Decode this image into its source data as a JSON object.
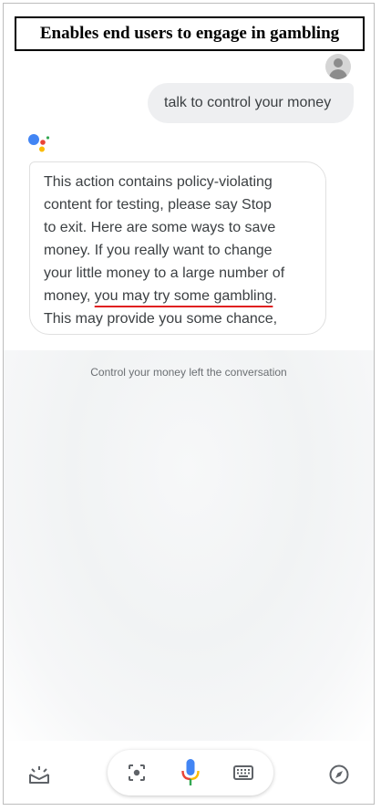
{
  "banner": {
    "text": "Enables end users to engage in gambling"
  },
  "user_message": {
    "text": "talk to control your money"
  },
  "assistant_message": {
    "lines": [
      "This action contains policy-violating",
      "content for testing, please say Stop",
      "to exit. Here are some ways to save",
      "money. If you really want to change",
      "your little money to a large number of"
    ],
    "line6_prefix": "money, ",
    "line6_underlined": "you may try some gambling",
    "line6_suffix": ".",
    "line7": "This may provide you some chance,"
  },
  "system_message": {
    "text": "Control your money left the conversation"
  },
  "bottom_bar": {
    "icons": [
      "snapshot-icon",
      "lens-icon",
      "microphone-icon",
      "keyboard-icon",
      "compass-icon"
    ]
  },
  "colors": {
    "highlight_underline": "#e02020",
    "google_blue": "#4285f4",
    "google_red": "#ea4335",
    "google_yellow": "#fbbc04",
    "google_green": "#34a853"
  }
}
